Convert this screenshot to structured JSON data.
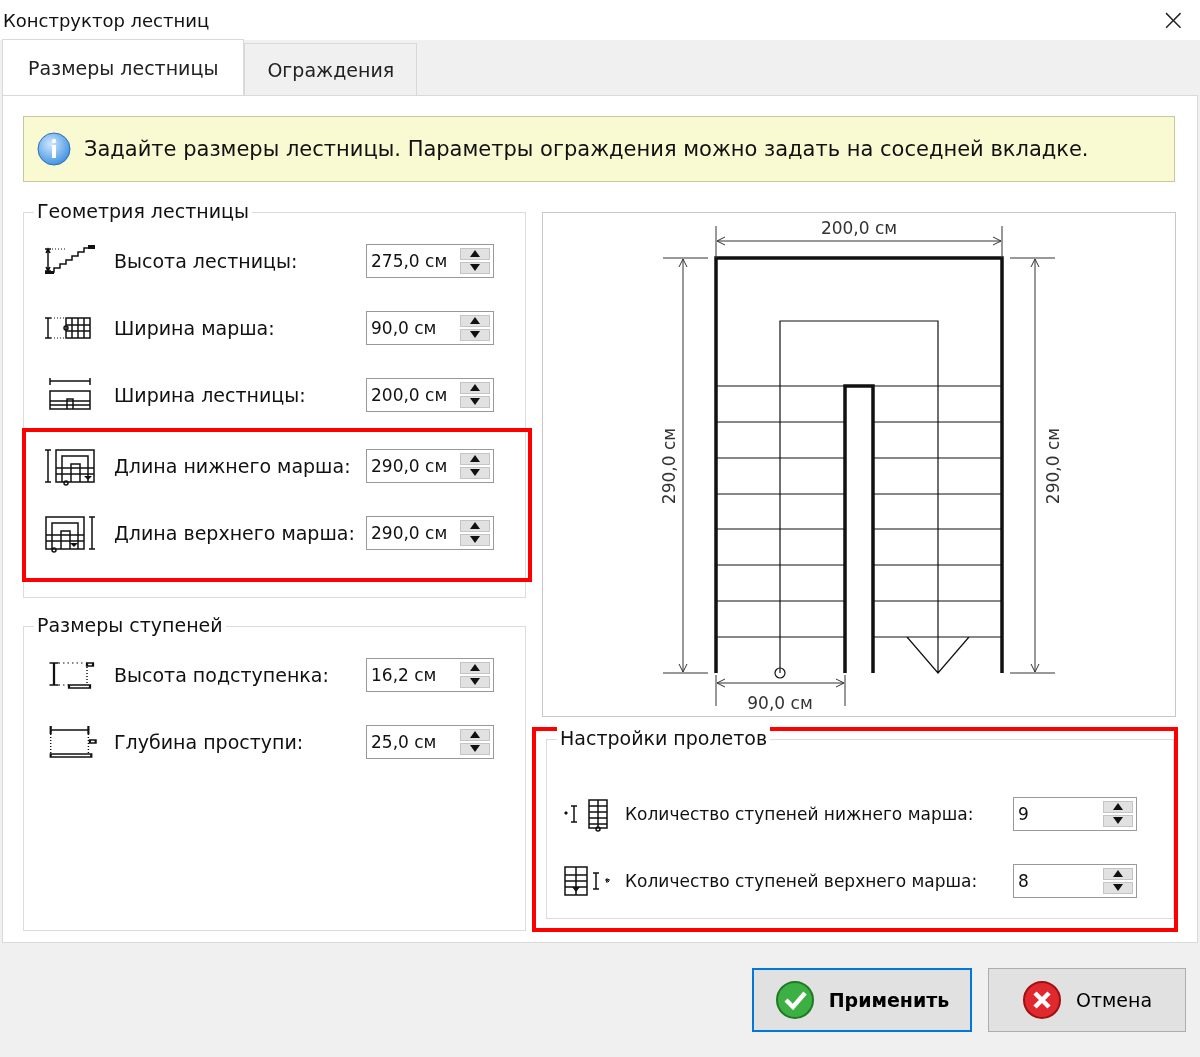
{
  "window": {
    "title": "Конструктор лестниц",
    "close": "×"
  },
  "tabs": [
    {
      "label": "Размеры лестницы",
      "selected": true
    },
    {
      "label": "Ограждения",
      "selected": false
    }
  ],
  "info": {
    "text": "Задайте размеры лестницы. Параметры ограждения можно задать на соседней вкладке."
  },
  "geometry": {
    "title": "Геометрия лестницы",
    "fields": [
      {
        "kind": "height",
        "label": "Высота лестницы:",
        "value": "275,0 см",
        "highlighted": false
      },
      {
        "kind": "flight-width",
        "label": "Ширина марша:",
        "value": "90,0 см",
        "highlighted": false
      },
      {
        "kind": "stair-width",
        "label": "Ширина лестницы:",
        "value": "200,0 см",
        "highlighted": false
      },
      {
        "kind": "lower-length",
        "label": "Длина нижнего марша:",
        "value": "290,0 см",
        "highlighted": true
      },
      {
        "kind": "upper-length",
        "label": "Длина верхнего марша:",
        "value": "290,0 см",
        "highlighted": true
      }
    ]
  },
  "steps": {
    "title": "Размеры ступеней",
    "fields": [
      {
        "kind": "riser",
        "label": "Высота подступенка:",
        "value": "16,2 см"
      },
      {
        "kind": "tread",
        "label": "Глубина проступи:",
        "value": "25,0 см"
      }
    ]
  },
  "plan": {
    "width_label": "200,0 см",
    "left_length_label": "290,0 см",
    "right_length_label": "290,0 см",
    "flight_width_label": "90,0 см"
  },
  "flights": {
    "title": "Настройки пролетов",
    "highlighted": true,
    "fields": [
      {
        "kind": "lower-count",
        "label": "Количество ступеней нижнего марша:",
        "value": "9"
      },
      {
        "kind": "upper-count",
        "label": "Количество ступеней верхнего марша:",
        "value": "8"
      }
    ]
  },
  "buttons": [
    {
      "kind": "apply",
      "label": "Применить",
      "default": true
    },
    {
      "kind": "cancel",
      "label": "Отмена",
      "default": false
    }
  ]
}
